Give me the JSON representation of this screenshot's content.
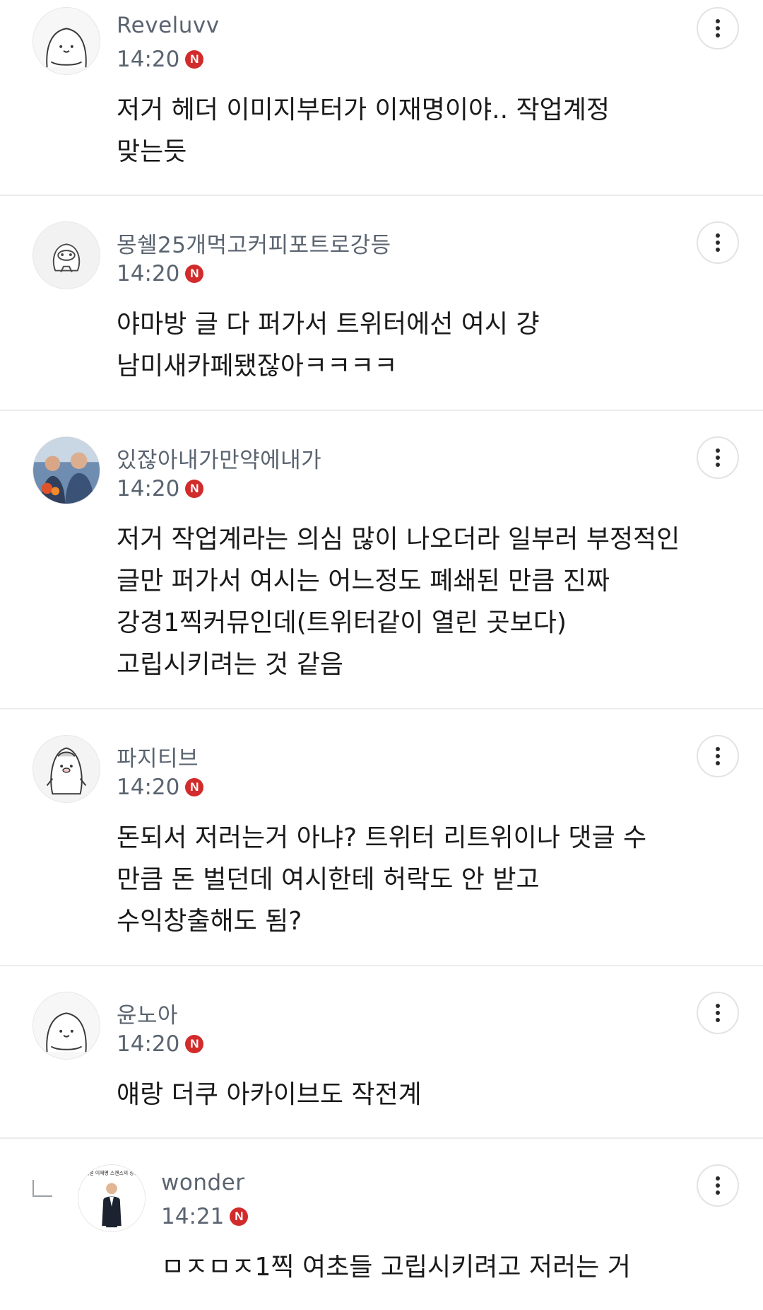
{
  "comments": [
    {
      "nickname": "Reveluvv",
      "time": "14:20",
      "badge": "N",
      "text": "저거 헤더 이미지부터가 이재명이야.. 작업계정\n맞는듯",
      "avatar": "seal-character-avatar"
    },
    {
      "nickname": "몽쉘25개먹고커피포트로강등",
      "time": "14:20",
      "badge": "N",
      "text": "야마방 글 다 퍼가서 트위터에선 여시 걍\n남미새카페됐잖아ㅋㅋㅋㅋ",
      "avatar": "duck-character-avatar"
    },
    {
      "nickname": "있잖아내가만약에내가",
      "time": "14:20",
      "badge": "N",
      "text": "저거 작업계라는 의심 많이 나오더라 일부러 부정적인\n글만 퍼가서 여시는 어느정도 폐쇄된 만큼 진짜\n강경1찍커뮤인데(트위터같이 열린 곳보다)\n고립시키려는 것 같음",
      "avatar": "photo-avatar"
    },
    {
      "nickname": "파지티브",
      "time": "14:20",
      "badge": "N",
      "text": "돈되서 저러는거 아냐? 트위터 리트위이나 댓글 수\n만큼 돈 벌던데 여시한테 허락도 안 받고\n수익창출해도 됨?",
      "avatar": "penguin-character-avatar"
    },
    {
      "nickname": "윤노아",
      "time": "14:20",
      "badge": "N",
      "text": "얘랑 더쿠 아카이브도 작전계",
      "avatar": "seal-character-avatar"
    },
    {
      "nickname": "wonder",
      "time": "14:21",
      "badge": "N",
      "text": "ㅁㅈㅁㅈ1찍 여초들 고립시키려고 저러는 거",
      "avatar": "poster-avatar",
      "avatar_caption": "리얼 이재명 스캔스의 상황",
      "is_reply": true
    }
  ],
  "colors": {
    "nickname": "#5a6470",
    "body_text": "#1a1a1a",
    "new_badge": "#d22b2b",
    "divider": "#ececec"
  },
  "icons": {
    "more": "more-vertical-icon",
    "reply": "reply-arrow-icon",
    "new": "new-badge-icon"
  }
}
